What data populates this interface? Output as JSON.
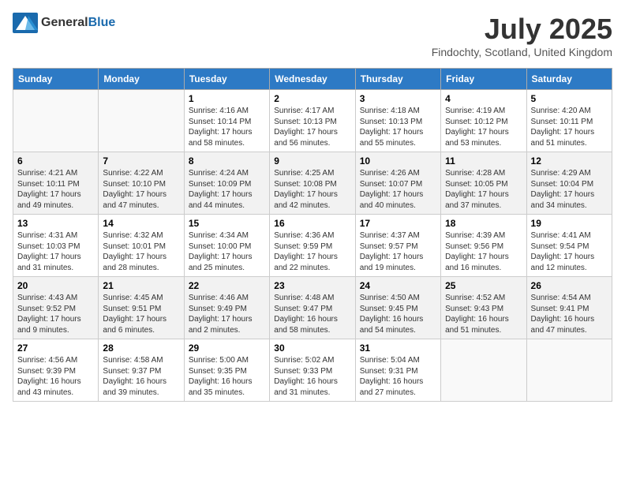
{
  "logo": {
    "text_general": "General",
    "text_blue": "Blue"
  },
  "title": "July 2025",
  "subtitle": "Findochty, Scotland, United Kingdom",
  "days_of_week": [
    "Sunday",
    "Monday",
    "Tuesday",
    "Wednesday",
    "Thursday",
    "Friday",
    "Saturday"
  ],
  "weeks": [
    [
      {
        "day": "",
        "sunrise": "",
        "sunset": "",
        "daylight": "",
        "empty": true
      },
      {
        "day": "",
        "sunrise": "",
        "sunset": "",
        "daylight": "",
        "empty": true
      },
      {
        "day": "1",
        "sunrise": "Sunrise: 4:16 AM",
        "sunset": "Sunset: 10:14 PM",
        "daylight": "Daylight: 17 hours and 58 minutes."
      },
      {
        "day": "2",
        "sunrise": "Sunrise: 4:17 AM",
        "sunset": "Sunset: 10:13 PM",
        "daylight": "Daylight: 17 hours and 56 minutes."
      },
      {
        "day": "3",
        "sunrise": "Sunrise: 4:18 AM",
        "sunset": "Sunset: 10:13 PM",
        "daylight": "Daylight: 17 hours and 55 minutes."
      },
      {
        "day": "4",
        "sunrise": "Sunrise: 4:19 AM",
        "sunset": "Sunset: 10:12 PM",
        "daylight": "Daylight: 17 hours and 53 minutes."
      },
      {
        "day": "5",
        "sunrise": "Sunrise: 4:20 AM",
        "sunset": "Sunset: 10:11 PM",
        "daylight": "Daylight: 17 hours and 51 minutes."
      }
    ],
    [
      {
        "day": "6",
        "sunrise": "Sunrise: 4:21 AM",
        "sunset": "Sunset: 10:11 PM",
        "daylight": "Daylight: 17 hours and 49 minutes."
      },
      {
        "day": "7",
        "sunrise": "Sunrise: 4:22 AM",
        "sunset": "Sunset: 10:10 PM",
        "daylight": "Daylight: 17 hours and 47 minutes."
      },
      {
        "day": "8",
        "sunrise": "Sunrise: 4:24 AM",
        "sunset": "Sunset: 10:09 PM",
        "daylight": "Daylight: 17 hours and 44 minutes."
      },
      {
        "day": "9",
        "sunrise": "Sunrise: 4:25 AM",
        "sunset": "Sunset: 10:08 PM",
        "daylight": "Daylight: 17 hours and 42 minutes."
      },
      {
        "day": "10",
        "sunrise": "Sunrise: 4:26 AM",
        "sunset": "Sunset: 10:07 PM",
        "daylight": "Daylight: 17 hours and 40 minutes."
      },
      {
        "day": "11",
        "sunrise": "Sunrise: 4:28 AM",
        "sunset": "Sunset: 10:05 PM",
        "daylight": "Daylight: 17 hours and 37 minutes."
      },
      {
        "day": "12",
        "sunrise": "Sunrise: 4:29 AM",
        "sunset": "Sunset: 10:04 PM",
        "daylight": "Daylight: 17 hours and 34 minutes."
      }
    ],
    [
      {
        "day": "13",
        "sunrise": "Sunrise: 4:31 AM",
        "sunset": "Sunset: 10:03 PM",
        "daylight": "Daylight: 17 hours and 31 minutes."
      },
      {
        "day": "14",
        "sunrise": "Sunrise: 4:32 AM",
        "sunset": "Sunset: 10:01 PM",
        "daylight": "Daylight: 17 hours and 28 minutes."
      },
      {
        "day": "15",
        "sunrise": "Sunrise: 4:34 AM",
        "sunset": "Sunset: 10:00 PM",
        "daylight": "Daylight: 17 hours and 25 minutes."
      },
      {
        "day": "16",
        "sunrise": "Sunrise: 4:36 AM",
        "sunset": "Sunset: 9:59 PM",
        "daylight": "Daylight: 17 hours and 22 minutes."
      },
      {
        "day": "17",
        "sunrise": "Sunrise: 4:37 AM",
        "sunset": "Sunset: 9:57 PM",
        "daylight": "Daylight: 17 hours and 19 minutes."
      },
      {
        "day": "18",
        "sunrise": "Sunrise: 4:39 AM",
        "sunset": "Sunset: 9:56 PM",
        "daylight": "Daylight: 17 hours and 16 minutes."
      },
      {
        "day": "19",
        "sunrise": "Sunrise: 4:41 AM",
        "sunset": "Sunset: 9:54 PM",
        "daylight": "Daylight: 17 hours and 12 minutes."
      }
    ],
    [
      {
        "day": "20",
        "sunrise": "Sunrise: 4:43 AM",
        "sunset": "Sunset: 9:52 PM",
        "daylight": "Daylight: 17 hours and 9 minutes."
      },
      {
        "day": "21",
        "sunrise": "Sunrise: 4:45 AM",
        "sunset": "Sunset: 9:51 PM",
        "daylight": "Daylight: 17 hours and 6 minutes."
      },
      {
        "day": "22",
        "sunrise": "Sunrise: 4:46 AM",
        "sunset": "Sunset: 9:49 PM",
        "daylight": "Daylight: 17 hours and 2 minutes."
      },
      {
        "day": "23",
        "sunrise": "Sunrise: 4:48 AM",
        "sunset": "Sunset: 9:47 PM",
        "daylight": "Daylight: 16 hours and 58 minutes."
      },
      {
        "day": "24",
        "sunrise": "Sunrise: 4:50 AM",
        "sunset": "Sunset: 9:45 PM",
        "daylight": "Daylight: 16 hours and 54 minutes."
      },
      {
        "day": "25",
        "sunrise": "Sunrise: 4:52 AM",
        "sunset": "Sunset: 9:43 PM",
        "daylight": "Daylight: 16 hours and 51 minutes."
      },
      {
        "day": "26",
        "sunrise": "Sunrise: 4:54 AM",
        "sunset": "Sunset: 9:41 PM",
        "daylight": "Daylight: 16 hours and 47 minutes."
      }
    ],
    [
      {
        "day": "27",
        "sunrise": "Sunrise: 4:56 AM",
        "sunset": "Sunset: 9:39 PM",
        "daylight": "Daylight: 16 hours and 43 minutes."
      },
      {
        "day": "28",
        "sunrise": "Sunrise: 4:58 AM",
        "sunset": "Sunset: 9:37 PM",
        "daylight": "Daylight: 16 hours and 39 minutes."
      },
      {
        "day": "29",
        "sunrise": "Sunrise: 5:00 AM",
        "sunset": "Sunset: 9:35 PM",
        "daylight": "Daylight: 16 hours and 35 minutes."
      },
      {
        "day": "30",
        "sunrise": "Sunrise: 5:02 AM",
        "sunset": "Sunset: 9:33 PM",
        "daylight": "Daylight: 16 hours and 31 minutes."
      },
      {
        "day": "31",
        "sunrise": "Sunrise: 5:04 AM",
        "sunset": "Sunset: 9:31 PM",
        "daylight": "Daylight: 16 hours and 27 minutes."
      },
      {
        "day": "",
        "sunrise": "",
        "sunset": "",
        "daylight": "",
        "empty": true
      },
      {
        "day": "",
        "sunrise": "",
        "sunset": "",
        "daylight": "",
        "empty": true
      }
    ]
  ]
}
